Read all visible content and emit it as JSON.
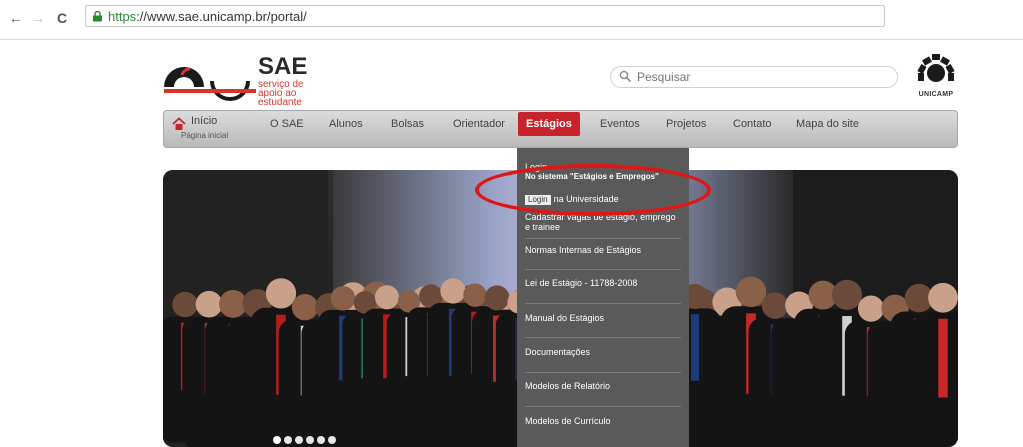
{
  "browser": {
    "back_label": "←",
    "forward_label": "→",
    "reload_label": "C",
    "url_scheme": "https",
    "url_rest": "://www.sae.unicamp.br/portal/"
  },
  "header": {
    "logo_title": "SAE",
    "logo_subtitle_lines": [
      "serviço de",
      "apoio ao",
      "estudante"
    ],
    "search_placeholder": "Pesquisar",
    "unicamp_label": "UNICAMP"
  },
  "menu": {
    "home_label": "Início",
    "home_sub": "Página inicial",
    "items": [
      {
        "label": "O SAE"
      },
      {
        "label": "Alunos"
      },
      {
        "label": "Bolsas"
      },
      {
        "label": "Orientador"
      },
      {
        "label": "Estágios",
        "active": true
      },
      {
        "label": "Eventos"
      },
      {
        "label": "Projetos"
      },
      {
        "label": "Contato"
      },
      {
        "label": "Mapa do site"
      }
    ]
  },
  "dropdown": {
    "login_line1": "Login",
    "login_line2": "No sistema \"Estágios e Empregos\"",
    "badge_text": "Login",
    "badge_rest": "na Universidade",
    "items": [
      "Cadastrar vagas de estágio, emprego e trainee",
      "Normas Internas de Estágios",
      "Lei de Estágio - 11788-2008",
      "Manual do Estágios",
      "Documentações",
      "Modelos de Relatório",
      "Modelos de Currículo"
    ]
  },
  "colors": {
    "accent_red": "#c8232c",
    "menu_gray": "#c4c4c4",
    "dropdown_bg": "#5a5a5a",
    "annotation": "#e01515"
  }
}
